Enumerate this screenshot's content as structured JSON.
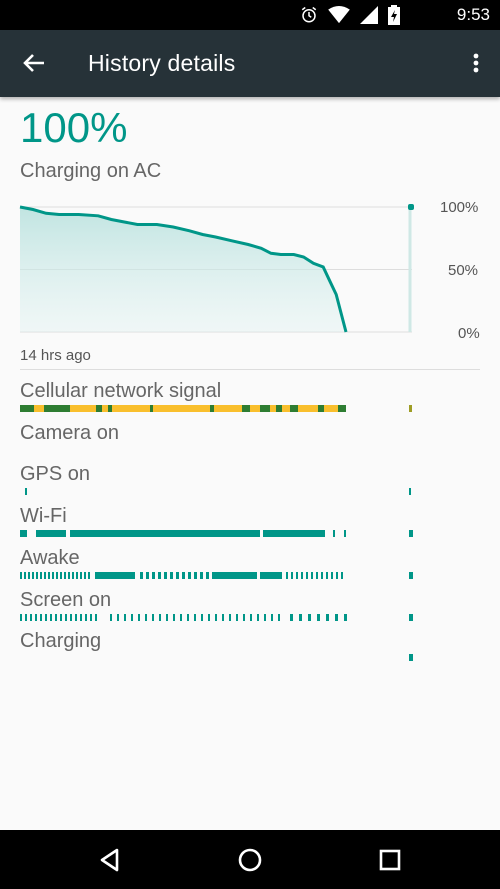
{
  "status_bar": {
    "time": "9:53",
    "icons": [
      "alarm-icon",
      "wifi-icon",
      "cell-signal-icon",
      "battery-charging-icon"
    ]
  },
  "toolbar": {
    "title": "History details",
    "back_icon": "arrow-back-icon",
    "menu_icon": "more-vert-icon"
  },
  "battery": {
    "level": "100%",
    "status": "Charging on AC"
  },
  "chart_data": {
    "type": "area",
    "title": "",
    "xlabel": "",
    "ylabel": "",
    "y_tick_labels": [
      "100%",
      "50%",
      "0%"
    ],
    "ylim": [
      0,
      100
    ],
    "x_start_label": "14 hrs ago",
    "color": "#009688",
    "series": [
      {
        "values": [
          100,
          98,
          95,
          94,
          94,
          93,
          90,
          88,
          86,
          86,
          84,
          81,
          78,
          76,
          73,
          70,
          67,
          63,
          62,
          62,
          60,
          55,
          52,
          41,
          30,
          0
        ]
      }
    ],
    "x": [
      0,
      0.04,
      0.08,
      0.12,
      0.18,
      0.24,
      0.28,
      0.32,
      0.36,
      0.42,
      0.47,
      0.52,
      0.56,
      0.6,
      0.65,
      0.7,
      0.74,
      0.77,
      0.8,
      0.84,
      0.87,
      0.9,
      0.93,
      0.95,
      0.97,
      1.0
    ],
    "charging_marker": {
      "x": 1.0,
      "value": 100
    }
  },
  "time_axis": {
    "start_label": "14 hrs ago"
  },
  "tracks": [
    {
      "label": "Cellular network signal",
      "color": "#f9bf2d",
      "secondary": "#2e7d32",
      "mode": "signal"
    },
    {
      "label": "Camera on",
      "color": "#009688",
      "mode": "none"
    },
    {
      "label": "GPS on",
      "color": "#009688",
      "mode": "sparse"
    },
    {
      "label": "Wi-Fi",
      "color": "#009688",
      "mode": "dense"
    },
    {
      "label": "Awake",
      "color": "#009688",
      "mode": "mixed"
    },
    {
      "label": "Screen on",
      "color": "#009688",
      "mode": "ticks"
    },
    {
      "label": "Charging",
      "color": "#009688",
      "mode": "end"
    }
  ],
  "nav_bar": {
    "back_icon": "nav-back-icon",
    "home_icon": "nav-home-icon",
    "recents_icon": "nav-recents-icon"
  }
}
